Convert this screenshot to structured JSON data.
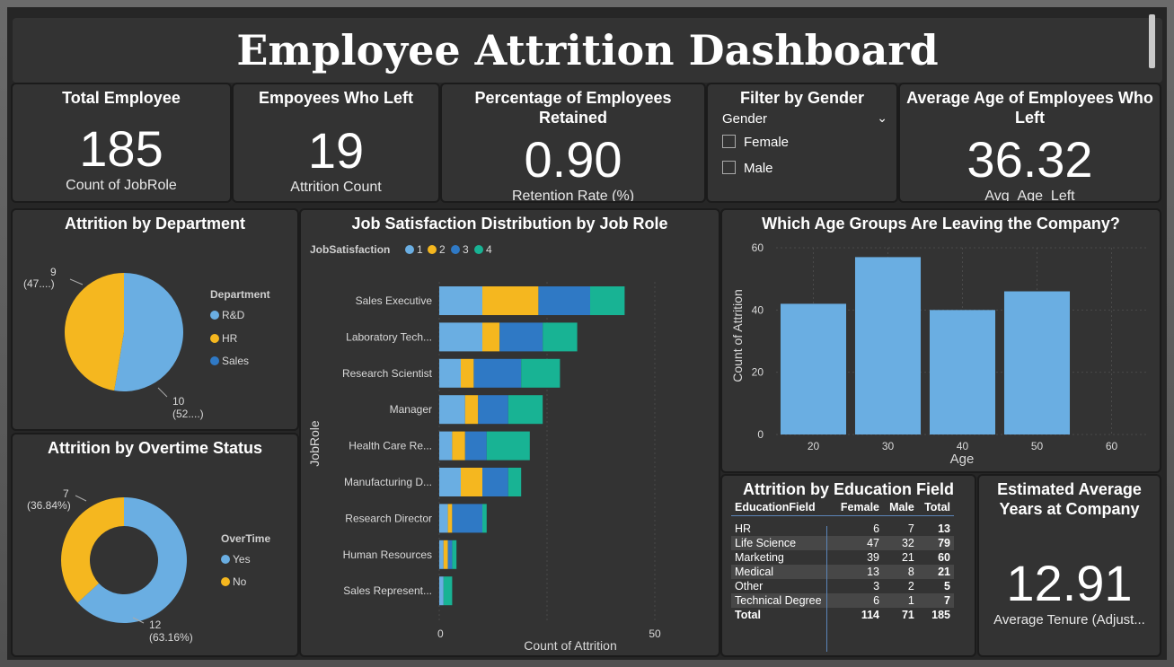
{
  "title": "Employee Attrition Dashboard",
  "kpis": {
    "total": {
      "title": "Total Employee",
      "value": "185",
      "label": "Count of JobRole"
    },
    "left": {
      "title": "Empoyees Who Left",
      "value": "19",
      "label": "Attrition Count"
    },
    "retained": {
      "title": "Percentage of Employees Retained",
      "value": "0.90",
      "label": "Retention Rate (%)"
    },
    "avg_age": {
      "title": "Average Age of Employees Who Left",
      "value": "36.32",
      "label": "Avg_Age_Left"
    },
    "tenure": {
      "title": "Estimated Average Years at Company",
      "value": "12.91",
      "label": "Average Tenure (Adjust..."
    }
  },
  "filter": {
    "title": "Filter by Gender",
    "dropdown_label": "Gender",
    "options": [
      "Female",
      "Male"
    ]
  },
  "colors": {
    "lightblue": "#6aaee2",
    "yellow": "#f5b71f",
    "darkblue": "#2f79c5",
    "teal": "#18b394"
  },
  "charts": {
    "department": {
      "title": "Attrition by Department",
      "legend_title": "Department",
      "legend": [
        "R&D",
        "HR",
        "Sales"
      ],
      "label_hr_value": "9",
      "label_hr_pct": "(47....)",
      "label_rd_value": "10",
      "label_rd_pct": "(52....)"
    },
    "overtime": {
      "title": "Attrition by Overtime Status",
      "legend_title": "OverTime",
      "legend": [
        "Yes",
        "No"
      ],
      "label_no_value": "7",
      "label_no_pct": "(36.84%)",
      "label_yes_value": "12",
      "label_yes_pct": "(63.16%)"
    },
    "jobsat": {
      "title": "Job Satisfaction Distribution by Job Role",
      "legend_title": "JobSatisfaction",
      "legend": [
        "1",
        "2",
        "3",
        "4"
      ],
      "ylabel": "JobRole",
      "xlabel": "Count of Attrition",
      "xticks": [
        "0",
        "50"
      ]
    },
    "age": {
      "title": "Which Age Groups Are Leaving the Company?",
      "ylabel": "Count of Attrition",
      "xlabel": "Age",
      "yticks": [
        "0",
        "20",
        "40",
        "60"
      ],
      "xticks": [
        "20",
        "30",
        "40",
        "50",
        "60"
      ]
    },
    "education": {
      "title": "Attrition by Education Field",
      "headers": [
        "EducationField",
        "Female",
        "Male",
        "Total"
      ],
      "rows": [
        [
          "HR",
          "6",
          "7",
          "13"
        ],
        [
          "Life Science",
          "47",
          "32",
          "79"
        ],
        [
          "Marketing",
          "39",
          "21",
          "60"
        ],
        [
          "Medical",
          "13",
          "8",
          "21"
        ],
        [
          "Other",
          "3",
          "2",
          "5"
        ],
        [
          "Technical Degree",
          "6",
          "1",
          "7"
        ]
      ],
      "total": [
        "Total",
        "114",
        "71",
        "185"
      ]
    }
  },
  "chart_data": [
    {
      "type": "pie",
      "title": "Attrition by Department",
      "legend_title": "Department",
      "categories": [
        "R&D",
        "HR",
        "Sales"
      ],
      "values": [
        10,
        9,
        0
      ]
    },
    {
      "type": "pie",
      "title": "Attrition by Overtime Status",
      "legend_title": "OverTime",
      "categories": [
        "Yes",
        "No"
      ],
      "values": [
        12,
        7
      ]
    },
    {
      "type": "bar",
      "title": "Job Satisfaction Distribution by Job Role",
      "orientation": "horizontal",
      "stacked": true,
      "xlabel": "Count of Attrition",
      "ylabel": "JobRole",
      "xlim": [
        0,
        50
      ],
      "categories": [
        "Sales Executive",
        "Laboratory Tech...",
        "Research Scientist",
        "Manager",
        "Health Care Re...",
        "Manufacturing D...",
        "Research Director",
        "Human Resources",
        "Sales Represent..."
      ],
      "series": [
        {
          "name": "1",
          "values": [
            10,
            10,
            5,
            6,
            3,
            5,
            2,
            1,
            1
          ]
        },
        {
          "name": "2",
          "values": [
            13,
            4,
            3,
            3,
            3,
            5,
            1,
            1,
            0
          ]
        },
        {
          "name": "3",
          "values": [
            12,
            10,
            11,
            7,
            5,
            6,
            7,
            1,
            0
          ]
        },
        {
          "name": "4",
          "values": [
            8,
            8,
            9,
            8,
            10,
            3,
            1,
            1,
            2
          ]
        }
      ]
    },
    {
      "type": "bar",
      "title": "Which Age Groups Are Leaving the Company?",
      "xlabel": "Age",
      "ylabel": "Count of Attrition",
      "categories": [
        "20",
        "30",
        "40",
        "50",
        "60"
      ],
      "values": [
        42,
        57,
        40,
        46
      ],
      "x": [
        20,
        30,
        40,
        50
      ],
      "ylim": [
        0,
        60
      ],
      "xlim": [
        15,
        65
      ]
    },
    {
      "type": "table",
      "title": "Attrition by Education Field",
      "columns": [
        "EducationField",
        "Female",
        "Male",
        "Total"
      ],
      "rows": [
        [
          "HR",
          6,
          7,
          13
        ],
        [
          "Life Science",
          47,
          32,
          79
        ],
        [
          "Marketing",
          39,
          21,
          60
        ],
        [
          "Medical",
          13,
          8,
          21
        ],
        [
          "Other",
          3,
          2,
          5
        ],
        [
          "Technical Degree",
          6,
          1,
          7
        ],
        [
          "Total",
          114,
          71,
          185
        ]
      ]
    }
  ]
}
